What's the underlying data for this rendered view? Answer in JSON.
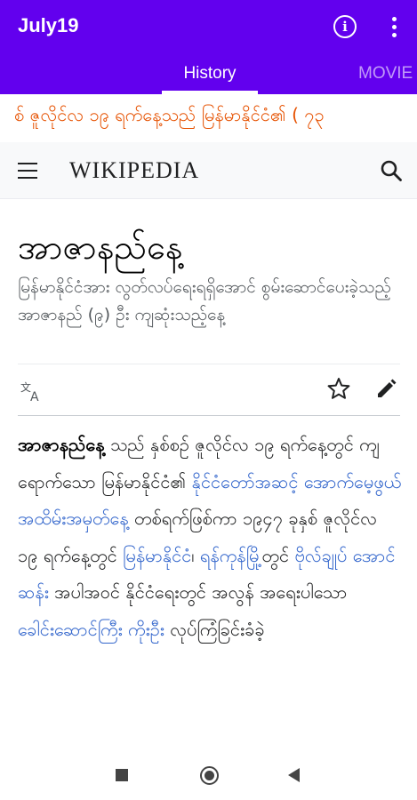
{
  "app": {
    "title": "July19",
    "icons": {
      "info": "info-icon",
      "overflow": "more-vert-icon"
    },
    "accent_color": "#6200ee"
  },
  "tabs": [
    {
      "label": "History",
      "active": true
    },
    {
      "label": "MOVIE",
      "active": false
    }
  ],
  "ticker": {
    "text": "စ် ဇူလိုင်လ ၁၉ ရက်နေ့သည် မြန်မာနိုင်ငံ၏ ( ၇၃",
    "color": "#e65100"
  },
  "wiki_header": {
    "wordmark": "WIKIPEDIA",
    "icons": {
      "menu": "hamburger-menu-icon",
      "search": "search-icon"
    }
  },
  "article": {
    "title": "အာဇာနည်နေ့",
    "description": "မြန်မာနိုင်ငံအား လွတ်လပ်ရေးရရှိအောင် စွမ်းဆောင်ပေးခဲ့သည့် အာဇာနည် (၉) ဦး ကျဆုံးသည့်နေ့",
    "actions": {
      "language": "language-icon",
      "watch": "star-icon",
      "edit": "pencil-icon"
    },
    "body": {
      "bold_term": "အာဇာနည်နေ့",
      "text_1": " သည် နှစ်စဉ် ဇူလိုင်လ ၁၉ ရက်နေ့တွင် ကျရောက်သော မြန်မာနိုင်ငံ၏ ",
      "link_1": "နိုင်ငံတော်အဆင့် အောက်မေ့ဖွယ်အထိမ်းအမှတ်နေ့",
      "text_2": " တစ်ရက်ဖြစ်ကာ ၁၉၄၇ ခုနှစ် ဇူလိုင်လ ၁၉ ရက်နေ့တွင် ",
      "link_2": "မြန်မာနိုင်ငံ",
      "text_3": "၊ ",
      "link_3": "ရန်ကုန်မြို့",
      "text_4": "တွင် ",
      "link_4": "ဗိုလ်ချုပ် အောင်ဆန်း",
      "text_5": " အပါအဝင် နိုင်ငံရေးတွင် အလွန် အရေးပါသော ",
      "link_5": "ခေါင်းဆောင်ကြီး ကိုးဦး",
      "text_6": " လုပ်ကြံခြင်းခံခဲ့"
    }
  },
  "system_nav": {
    "icons": [
      "recents-icon",
      "home-icon",
      "back-icon"
    ]
  }
}
